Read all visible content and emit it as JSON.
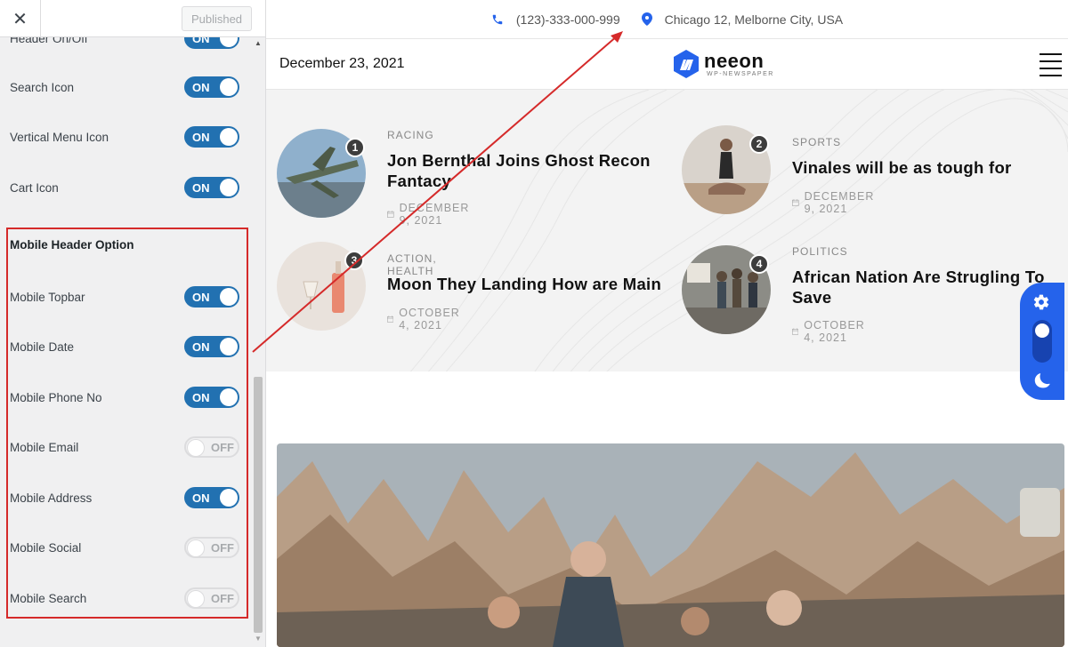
{
  "sidebar": {
    "close_label": "✕",
    "publish_label": "Published",
    "partial_top_label": "Header On/Off",
    "partial_top_state": "ON",
    "options": [
      {
        "label": "Search Icon",
        "state": "ON"
      },
      {
        "label": "Vertical Menu Icon",
        "state": "ON"
      },
      {
        "label": "Cart Icon",
        "state": "ON"
      }
    ],
    "mobile_group": {
      "title": "Mobile Header Option",
      "options": [
        {
          "label": "Mobile Topbar",
          "state": "ON"
        },
        {
          "label": "Mobile Date",
          "state": "ON"
        },
        {
          "label": "Mobile Phone No",
          "state": "ON"
        },
        {
          "label": "Mobile Email",
          "state": "OFF"
        },
        {
          "label": "Mobile Address",
          "state": "ON"
        },
        {
          "label": "Mobile Social",
          "state": "OFF"
        },
        {
          "label": "Mobile Search",
          "state": "OFF"
        }
      ]
    }
  },
  "preview": {
    "topbar": {
      "phone": "(123)-333-000-999",
      "address": "Chicago 12, Melborne City, USA"
    },
    "header": {
      "date": "December 23, 2021",
      "logo_name": "neeon",
      "logo_tagline": "WP-NEWSPAPER"
    },
    "posts": [
      {
        "num": "1",
        "category": "RACING",
        "title": "Jon Bernthal Joins Ghost Recon Fantacy",
        "date": "DECEMBER 9, 2021"
      },
      {
        "num": "2",
        "category": "SPORTS",
        "title": "Vinales will be as tough for",
        "date": "DECEMBER 9, 2021"
      },
      {
        "num": "3",
        "category": "ACTION, HEALTH",
        "title": "Moon They Landing How are Main",
        "date": "OCTOBER 4, 2021"
      },
      {
        "num": "4",
        "category": "POLITICS",
        "title": "African Nation Are Strugling To Save",
        "date": "OCTOBER 4, 2021"
      }
    ]
  },
  "colors": {
    "accent": "#2271b1",
    "annotation": "#d52a2a",
    "float_panel": "#2563eb"
  }
}
